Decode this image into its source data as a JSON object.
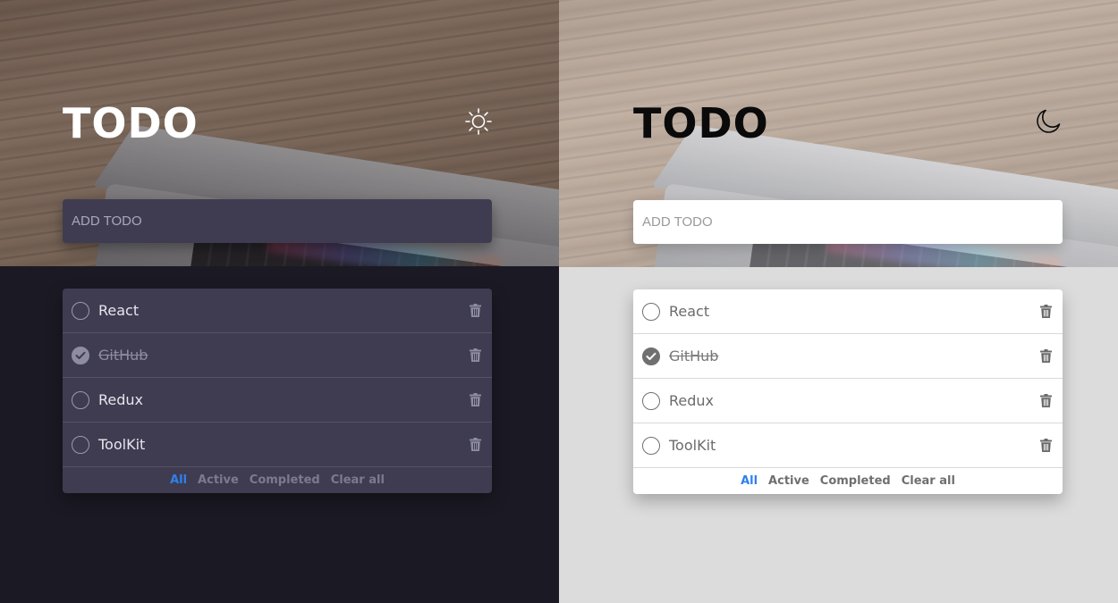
{
  "dark": {
    "title": "TODO",
    "theme_icon": "sun-icon",
    "add_placeholder": "ADD TODO",
    "todos": [
      {
        "label": "React",
        "completed": false
      },
      {
        "label": "GitHub",
        "completed": true
      },
      {
        "label": "Redux",
        "completed": false
      },
      {
        "label": "ToolKit",
        "completed": false
      }
    ],
    "filters": {
      "all": "All",
      "active": "Active",
      "completed": "Completed",
      "clear": "Clear all",
      "selected": "All"
    }
  },
  "light": {
    "title": "TODO",
    "theme_icon": "moon-icon",
    "add_placeholder": "ADD TODO",
    "todos": [
      {
        "label": "React",
        "completed": false
      },
      {
        "label": "GitHub",
        "completed": true
      },
      {
        "label": "Redux",
        "completed": false
      },
      {
        "label": "ToolKit",
        "completed": false
      }
    ],
    "filters": {
      "all": "All",
      "active": "Active",
      "completed": "Completed",
      "clear": "Clear all",
      "selected": "All"
    }
  },
  "colors": {
    "accent": "#2f80ed",
    "dark_bg": "#1b1a24",
    "dark_card": "#3f3c51",
    "light_bg": "#dcdcdc",
    "light_card": "#ffffff"
  }
}
